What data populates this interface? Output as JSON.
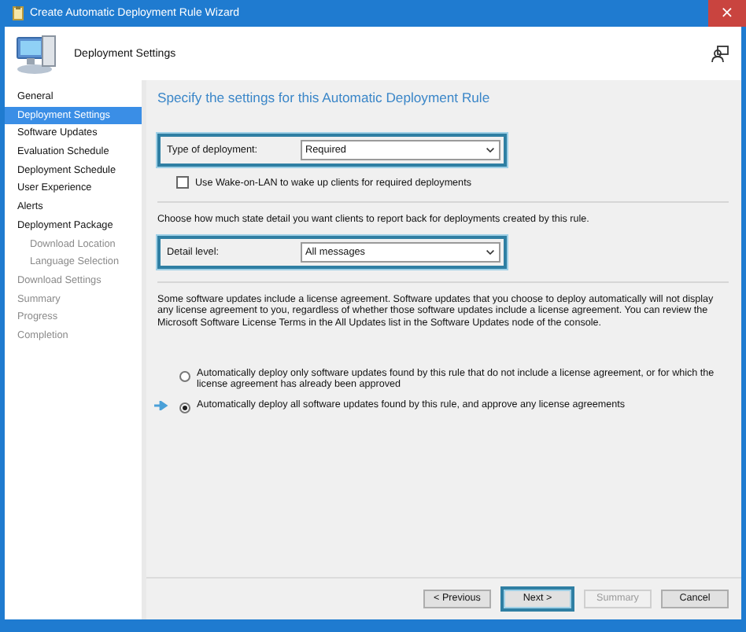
{
  "window": {
    "title": "Create Automatic Deployment Rule Wizard",
    "close": "×"
  },
  "header": {
    "title": "Deployment Settings"
  },
  "sidebar": {
    "items": [
      {
        "label": "General",
        "selected": false,
        "disabled": false
      },
      {
        "label": "Deployment Settings",
        "selected": true,
        "disabled": false
      },
      {
        "label": "Software Updates",
        "selected": false,
        "disabled": false
      },
      {
        "label": "Evaluation Schedule",
        "selected": false,
        "disabled": false
      },
      {
        "label": "Deployment Schedule",
        "selected": false,
        "disabled": false
      },
      {
        "label": "User Experience",
        "selected": false,
        "disabled": false
      },
      {
        "label": "Alerts",
        "selected": false,
        "disabled": false
      },
      {
        "label": "Deployment Package",
        "selected": false,
        "disabled": false,
        "children": [
          {
            "label": "Download Location",
            "selected": false,
            "disabled": true
          },
          {
            "label": "Language Selection",
            "selected": false,
            "disabled": true
          }
        ]
      },
      {
        "label": "Download Settings",
        "selected": false,
        "disabled": true
      },
      {
        "label": "Summary",
        "selected": false,
        "disabled": true
      },
      {
        "label": "Progress",
        "selected": false,
        "disabled": true
      },
      {
        "label": "Completion",
        "selected": false,
        "disabled": true
      }
    ]
  },
  "content": {
    "heading": "Specify the settings for this Automatic Deployment Rule",
    "deployment_type": {
      "label": "Type of deployment:",
      "value": "Required",
      "highlighted": true
    },
    "wake_on_lan": {
      "label": "Use Wake-on-LAN to wake up clients for required deployments",
      "checked": false
    },
    "detail_prompt": "Choose how much state detail you want clients to report back for deployments created by this rule.",
    "detail_level": {
      "label": "Detail level:",
      "value": "All messages",
      "highlighted": true
    },
    "license_text": "Some software updates include a license agreement. Software updates that you choose to deploy automatically will not display any license agreement to you, regardless of whether those software updates include a license agreement. You can review the Microsoft Software License Terms in the All Updates list in the Software Updates node of the console.",
    "license_options": [
      {
        "label": "Automatically deploy only software updates found by this rule that do not include a license agreement, or for which the license agreement has already been approved",
        "selected": false,
        "pointed": false
      },
      {
        "label": "Automatically deploy all software updates found by this rule, and approve any license agreements",
        "selected": true,
        "pointed": true
      }
    ]
  },
  "buttons": [
    {
      "label": "< Previous",
      "disabled": false,
      "highlighted": false
    },
    {
      "label": "Next >",
      "disabled": false,
      "highlighted": true
    },
    {
      "label": "Summary",
      "disabled": true,
      "highlighted": false
    },
    {
      "label": "Cancel",
      "disabled": false,
      "highlighted": false
    }
  ]
}
